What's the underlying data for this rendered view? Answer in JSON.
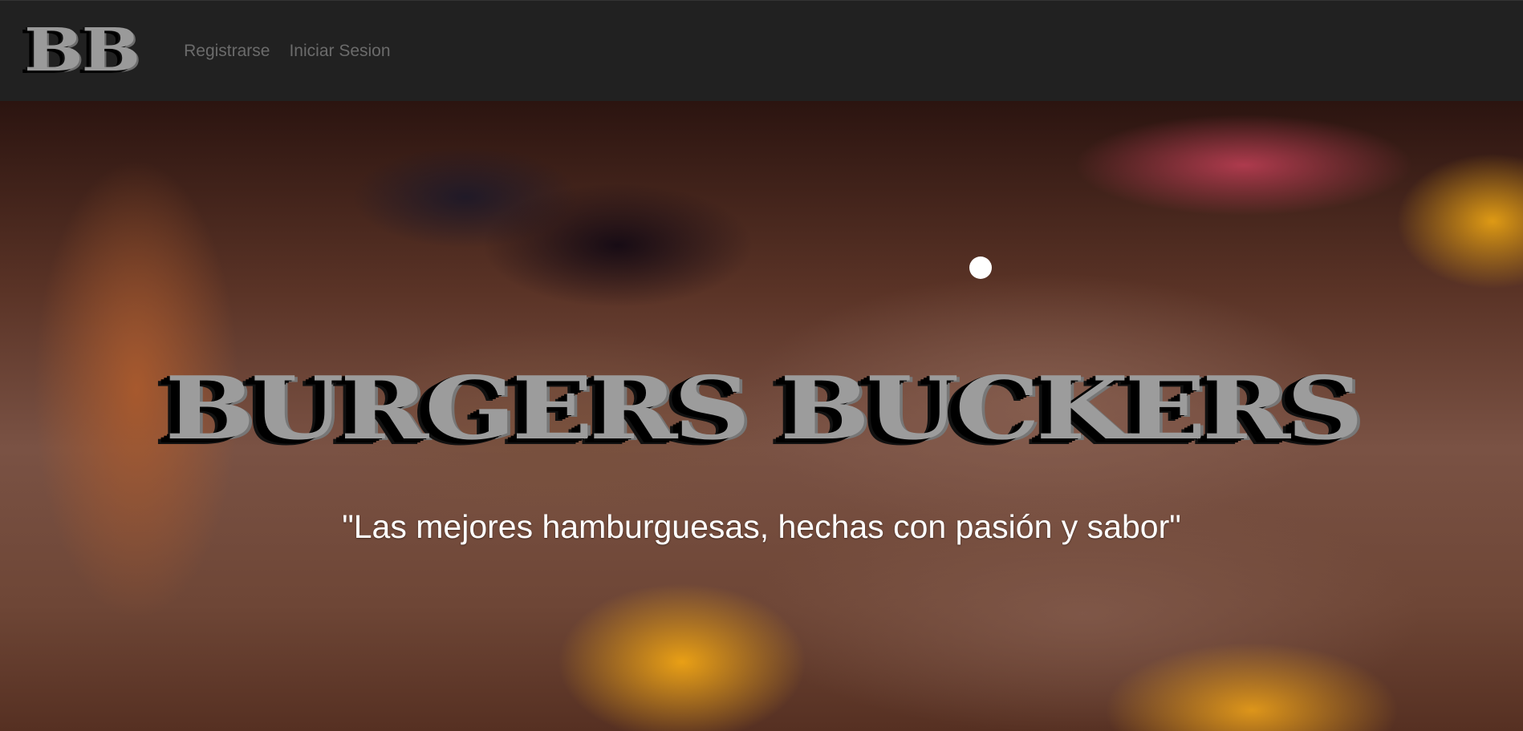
{
  "nav": {
    "logo": "BB",
    "links": [
      "Registrarse",
      "Iniciar Sesion"
    ]
  },
  "hero": {
    "title": "BURGERS BUCKERS",
    "subtitle": "\"Las mejores hamburguesas, hechas con pasión y sabor\"",
    "background_image": "burger-photo"
  },
  "colors": {
    "navbar_bg": "#212121",
    "logo_fill": "#9a9a9a",
    "nav_link": "#6b6b6b",
    "title_fill": "#9c9c9c",
    "subtitle": "#ffffff"
  }
}
